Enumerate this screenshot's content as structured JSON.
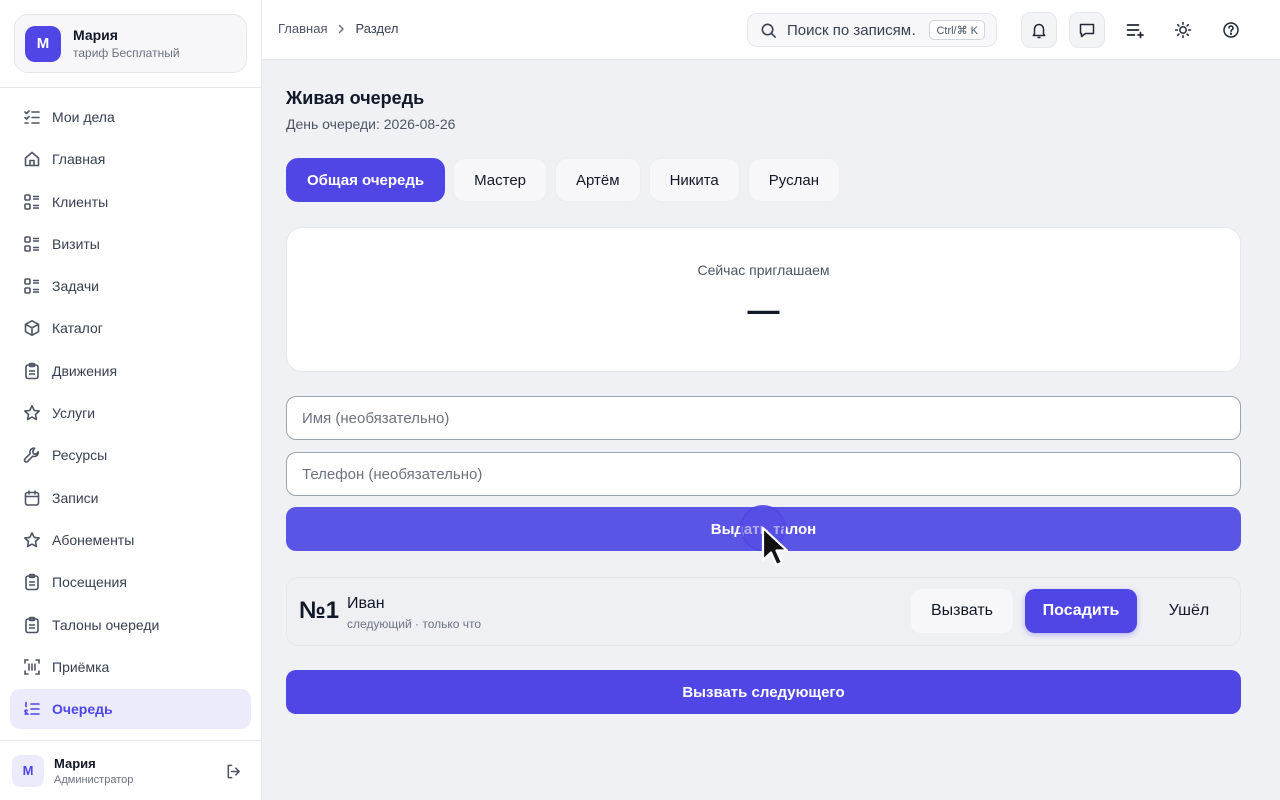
{
  "account": {
    "avatar_letter": "М",
    "name": "Мария",
    "plan": "тариф Бесплатный"
  },
  "nav": [
    {
      "label": "Мои дела",
      "icon": "checklist-icon"
    },
    {
      "label": "Главная",
      "icon": "home-icon"
    },
    {
      "label": "Клиенты",
      "icon": "list-icon"
    },
    {
      "label": "Визиты",
      "icon": "list-icon"
    },
    {
      "label": "Задачи",
      "icon": "list-icon"
    },
    {
      "label": "Каталог",
      "icon": "box-icon"
    },
    {
      "label": "Движения",
      "icon": "clipboard-icon"
    },
    {
      "label": "Услуги",
      "icon": "star-icon"
    },
    {
      "label": "Ресурсы",
      "icon": "wrench-icon"
    },
    {
      "label": "Записи",
      "icon": "calendar-icon"
    },
    {
      "label": "Абонементы",
      "icon": "star-icon"
    },
    {
      "label": "Посещения",
      "icon": "clipboard-icon"
    },
    {
      "label": "Талоны очереди",
      "icon": "clipboard-icon"
    },
    {
      "label": "Приёмка",
      "icon": "barcode-scan-icon"
    },
    {
      "label": "Очередь",
      "icon": "ordered-list-icon",
      "active": true
    }
  ],
  "user": {
    "avatar_letter": "М",
    "name": "Мария",
    "role": "Администратор"
  },
  "breadcrumb": {
    "home": "Главная",
    "current": "Раздел"
  },
  "search": {
    "placeholder": "Поиск по записям",
    "display": "Поиск по записям…",
    "shortcut": "Ctrl/⌘ K"
  },
  "page": {
    "title": "Живая очередь",
    "subtitle": "День очереди: 2026-08-26"
  },
  "tabs": [
    {
      "label": "Общая очередь",
      "active": true
    },
    {
      "label": "Мастер"
    },
    {
      "label": "Артём"
    },
    {
      "label": "Никита"
    },
    {
      "label": "Руслан"
    }
  ],
  "invite": {
    "label": "Сейчас приглашаем",
    "value": "—"
  },
  "form": {
    "name_placeholder": "Имя (необязательно)",
    "phone_placeholder": "Телефон (необязательно)",
    "issue_label": "Выдать талон"
  },
  "tickets": [
    {
      "number": "№1",
      "name": "Иван",
      "meta": "следующий · только что",
      "call_label": "Вызвать",
      "seat_label": "Посадить",
      "left_label": "Ушёл"
    }
  ],
  "next_label": "Вызвать следующего",
  "colors": {
    "accent": "#4f46e5",
    "accent_light": "#ebebfb",
    "background": "#f0f1f5"
  }
}
